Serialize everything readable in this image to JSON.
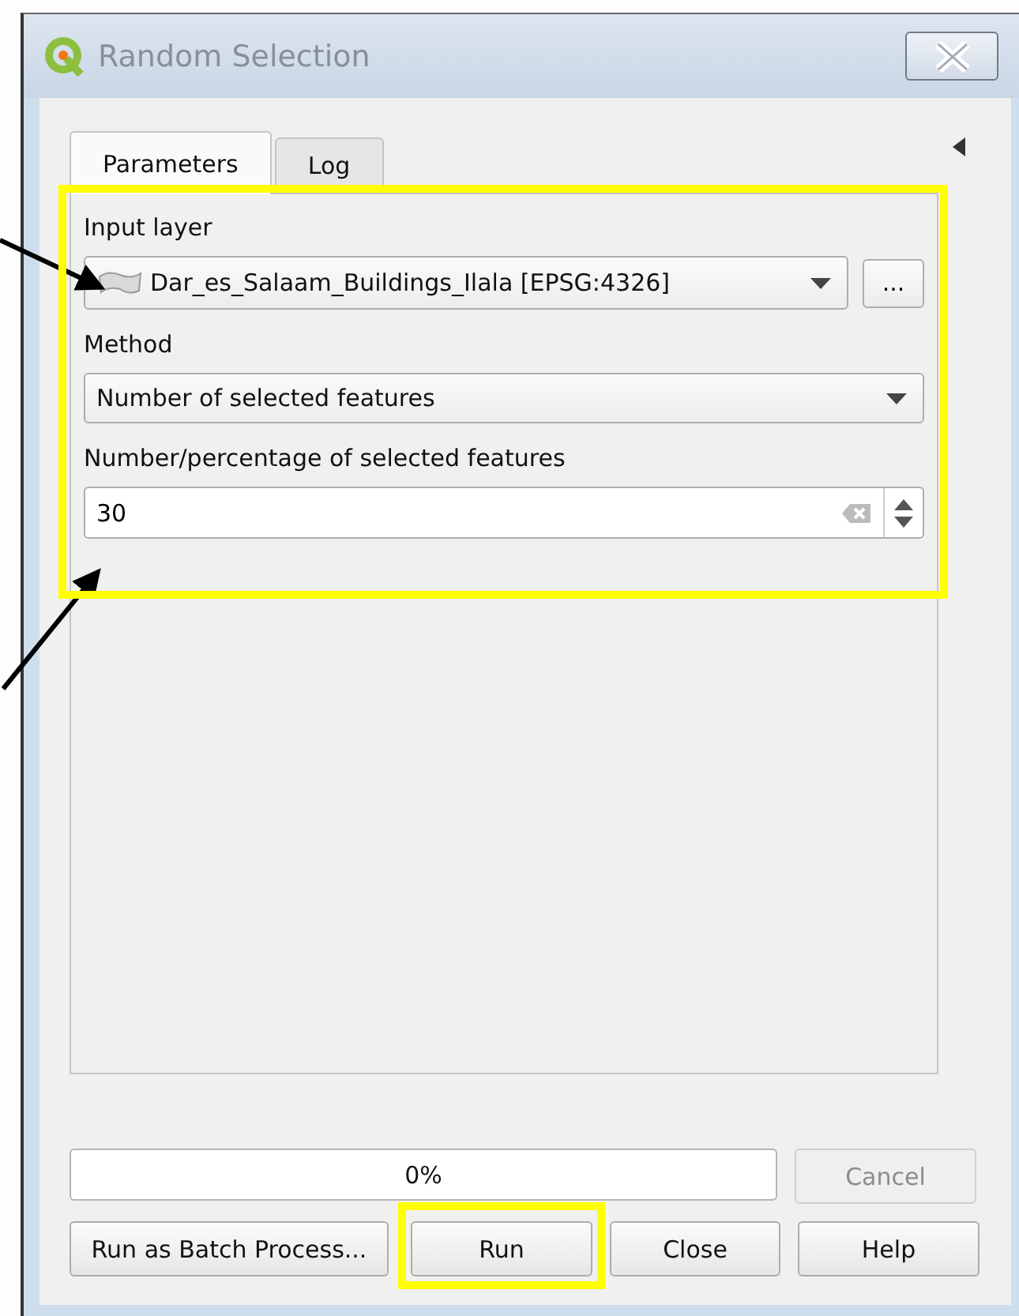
{
  "window": {
    "title": "Random Selection"
  },
  "tabs": [
    {
      "label": "Parameters",
      "selected": true
    },
    {
      "label": "Log",
      "selected": false
    }
  ],
  "parameters": [
    {
      "kind": "layer",
      "label": "Input layer",
      "value": "Dar_es_Salaam_Buildings_Ilala [EPSG:4326]",
      "button": "..."
    },
    {
      "kind": "combo",
      "label": "Method",
      "value": "Number of selected features"
    },
    {
      "kind": "spin",
      "label": "Number/percentage of selected features",
      "value": "30"
    }
  ],
  "progress": {
    "text": "0%"
  },
  "cancel": {
    "label": "Cancel",
    "disabled": true
  },
  "buttons": [
    {
      "label": "Run as Batch Process...",
      "disabled": false
    },
    {
      "label": "Run",
      "disabled": false
    },
    {
      "label": "Close",
      "disabled": false
    },
    {
      "label": "Help",
      "disabled": false
    }
  ]
}
